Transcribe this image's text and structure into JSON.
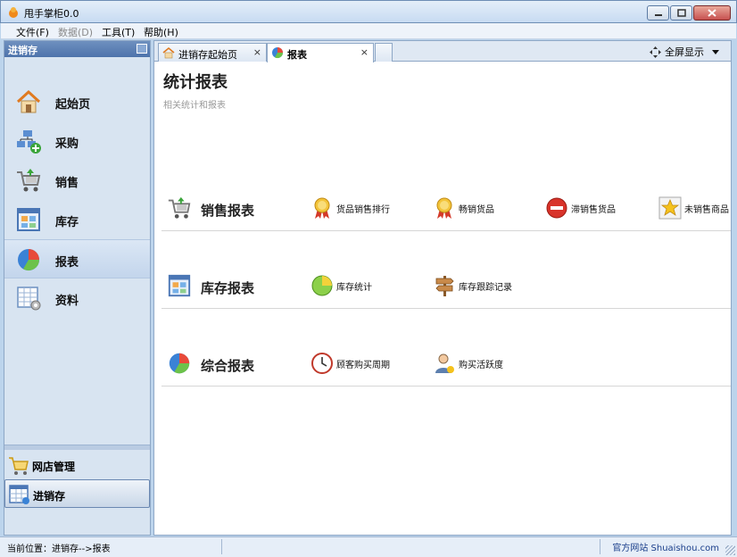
{
  "window": {
    "title": "甩手掌柜0.0"
  },
  "menu": {
    "file": "文件(F)",
    "data": "数据(D)",
    "tools": "工具(T)",
    "help": "帮助(H)"
  },
  "left_panel": {
    "header": "进销存",
    "items": [
      {
        "label": "起始页",
        "icon": "home-icon"
      },
      {
        "label": "采购",
        "icon": "purchase-icon"
      },
      {
        "label": "销售",
        "icon": "cart-icon"
      },
      {
        "label": "库存",
        "icon": "inventory-icon"
      },
      {
        "label": "报表",
        "icon": "pie-chart-icon"
      },
      {
        "label": "资料",
        "icon": "data-icon"
      }
    ],
    "active_item": "报表",
    "bottom_items": [
      {
        "label": "网店管理",
        "icon": "shop-cart-icon"
      },
      {
        "label": "进销存",
        "icon": "inventory-module-icon"
      }
    ]
  },
  "tabs": [
    {
      "label": "进销存起始页",
      "close": "×"
    },
    {
      "label": "报表",
      "close": "×"
    }
  ],
  "fullscreen_label": "全屏显示",
  "page": {
    "title": "统计报表",
    "subtitle": "相关统计和报表"
  },
  "sections": [
    {
      "title": "销售报表",
      "links": [
        "货品销售排行",
        "畅销货品",
        "滞销售货品",
        "未销售商品"
      ]
    },
    {
      "title": "库存报表",
      "links": [
        "库存统计",
        "库存跟踪记录"
      ]
    },
    {
      "title": "综合报表",
      "links": [
        "顾客购买周期",
        "购买活跃度"
      ]
    }
  ],
  "status": {
    "location": "当前位置：进销存-->报表",
    "website": "官方网站 Shuaishou.com"
  }
}
